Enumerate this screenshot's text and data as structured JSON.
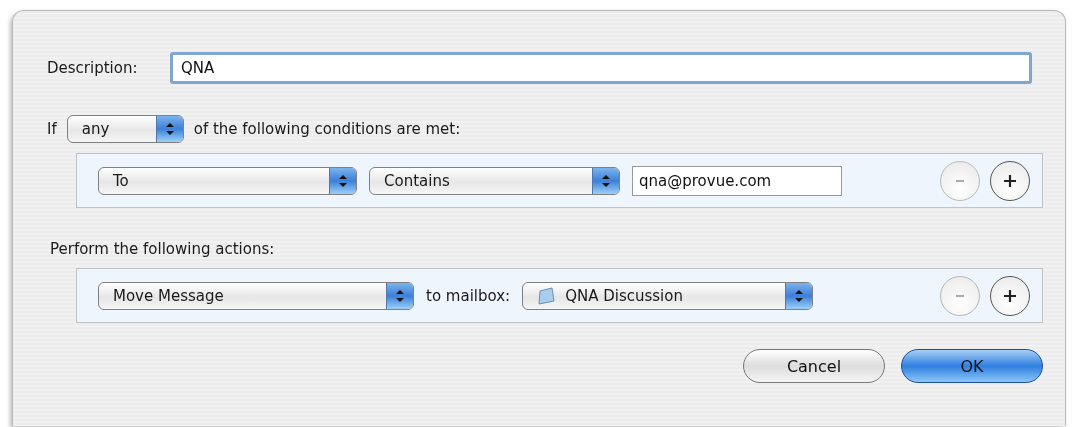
{
  "description": {
    "label": "Description:",
    "value": "QNA"
  },
  "match": {
    "prefix": "If",
    "value": "any",
    "suffix": "of the following conditions are met:"
  },
  "conditions": [
    {
      "field": "To",
      "operator": "Contains",
      "value": "qna@provue.com",
      "remove_disabled": true
    }
  ],
  "actions_label": "Perform the following actions:",
  "actions": [
    {
      "action": "Move Message",
      "connector": "to mailbox:",
      "mailbox": "QNA Discussion",
      "remove_disabled": true
    }
  ],
  "buttons": [
    {
      "label": "Cancel",
      "default": false
    },
    {
      "label": "OK",
      "default": true
    }
  ]
}
